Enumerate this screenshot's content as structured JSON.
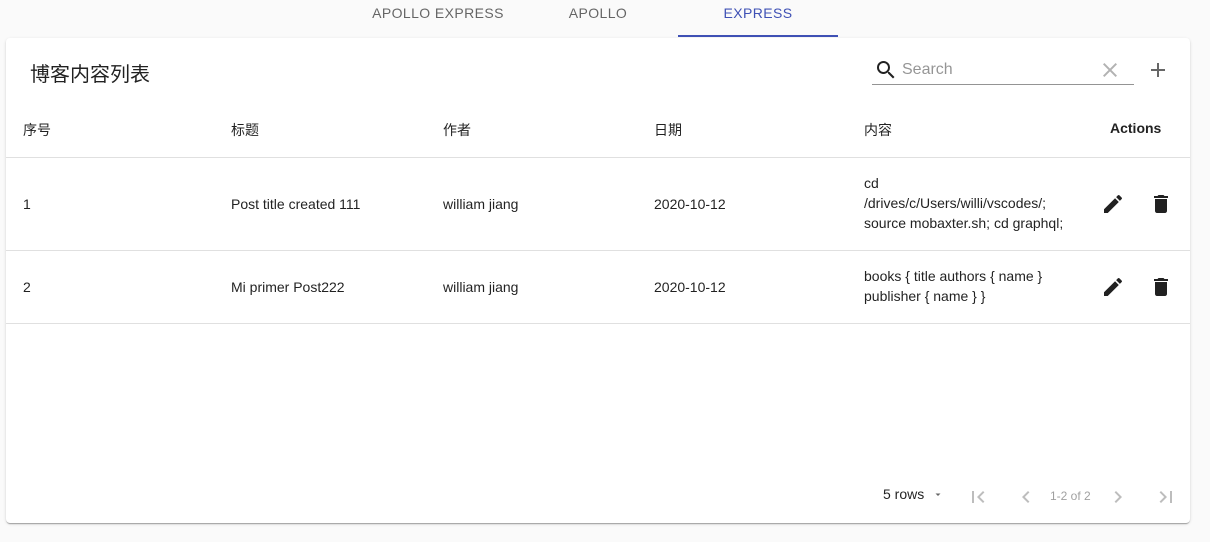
{
  "tabs": [
    {
      "label": "APOLLO EXPRESS"
    },
    {
      "label": "APOLLO"
    },
    {
      "label": "EXPRESS"
    }
  ],
  "card": {
    "title": "博客内容列表",
    "search_placeholder": "Search"
  },
  "table": {
    "headers": [
      "序号",
      "标题",
      "作者",
      "日期",
      "内容",
      "Actions"
    ],
    "rows": [
      {
        "id": "1",
        "title": "Post title created 111",
        "author": "william jiang",
        "date": "2020-10-12",
        "content_lines": [
          "cd",
          "/drives/c/Users/willi/vscodes/;",
          "source mobaxter.sh; cd graphql;"
        ]
      },
      {
        "id": "2",
        "title": "Mi primer Post222",
        "author": "william jiang",
        "date": "2020-10-12",
        "content_lines": [
          "books { title authors { name }",
          "publisher { name } }"
        ]
      }
    ]
  },
  "pagination": {
    "rows_label": "5 rows",
    "range_text": "1-2 of 2"
  },
  "colors": {
    "accent": "#3f51b5"
  }
}
